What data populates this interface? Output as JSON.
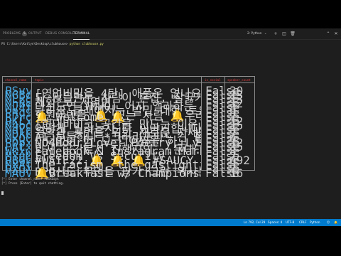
{
  "panel": {
    "tabs": [
      {
        "label": "PROBLEMS",
        "count": "5"
      },
      {
        "label": "OUTPUT",
        "count": ""
      },
      {
        "label": "DEBUG CONSOLE",
        "count": ""
      },
      {
        "label": "TERMINAL",
        "count": ""
      }
    ],
    "active_tab": "TERMINAL",
    "terminal_select": "2: Python",
    "icons": [
      "plus-icon",
      "split-icon",
      "trash-icon",
      "chevron-up-icon",
      "close-icon"
    ]
  },
  "terminal": {
    "prompt_line": {
      "prompt": "PS C:\\Users\\Kotlyn\\Desktop\\clubhouse>",
      "command": "python clubhouse.py"
    },
    "table": {
      "headers": [
        "channel_name",
        "topic",
        "is_social",
        "speaker_count"
      ],
      "rows": [
        {
          "name": "PSvyzkbn",
          "topic": "[영업비밀을 4탄] 애플은 없나요. 자목은주국로 M.정관 시연다",
          "social": "False",
          "count": "30"
        },
        {
          "name": "MGBdcXda",
          "topic": "되 많을만는 사람이 혼잡, 잘끓기 3편",
          "social": "False",
          "count": "13"
        },
        {
          "name": "MLzd7ErK",
          "topic": "체험 노 지역변",
          "social": "False",
          "count": "13"
        },
        {
          "name": "MnBqtYwx",
          "topic": "다전도연 (MVO) 어지 앨라하는 사람들은 수다방",
          "social": "False",
          "count": "12"
        },
        {
          "name": "Mv4fm40k",
          "topic": "근리오 클래에서는 발밑 대한 토요",
          "social": "False",
          "count": "8"
        },
        {
          "name": "PRq9nrUX",
          "topic": "학원무방들 🔔 있는 사람 🔔우리무방 규칙 동일 🔔친두와 섬지 기프티콘",
          "social": "False",
          "count": "9"
        },
        {
          "name": "R7roRMS3",
          "topic": "🔔 Welcome 🔔",
          "social": "False",
          "count": "7"
        },
        {
          "name": "PKLx5xsJ",
          "topic": "[현대바이크 공간을 만드는 이유]현대자인 출지하자에게 물어요:)",
          "social": "False",
          "count": "12"
        },
        {
          "name": "M4bdsKBE",
          "topic": "어떻게 밀랴는지 다 이야기합니다 🔔🔔 [정년다] 친척은 좋을듯",
          "social": "False",
          "count": "15"
        },
        {
          "name": "MdYqQYKk",
          "topic": "음악과 공연을 위한 새로운 자세와 꿈이 펼쳐를 거쳐친",
          "social": "False",
          "count": "5"
        },
        {
          "name": "MDkCmDlW",
          "topic": "AI 투툼하나 *크러리프피* 긴 철 변디 (~ 633 00:00)",
          "social": "False",
          "count": "7"
        },
        {
          "name": "MxQ0UeGM",
          "topic": "미덕없이 더 모 디이찜을 하고 탐장이요",
          "social": "False",
          "count": "6"
        },
        {
          "name": "PDpxKMWA",
          "topic": "NO4Hour2Love: Poetry, Lyrics & You",
          "social": "False",
          "count": "12"
        },
        {
          "name": "PAtxnDNH",
          "topic": "와세 공간로서 진행지의...문대...",
          "social": "False",
          "count": "35"
        },
        {
          "name": "Wkxw4V8",
          "topic": "Facebook & Instagram Marketing SECRETS 🔥💸🤑🤑",
          "social": "False",
          "count": "8"
        },
        {
          "name": "MYgMnEVy",
          "topic": "Freedom Vs Security",
          "social": "False",
          "count": "7"
        },
        {
          "name": "PBGhG84M",
          "topic": "#WAIF22 🔔 🔔 🔔 #SAUCY 🔔 AAAGEXXXX 🔔 ThankYou 🔔 AAXXXX",
          "social": "False",
          "count": "692"
        },
        {
          "name": "MXAfCUg",
          "topic": "The racism, the gaslighting, the foolishness in that room?",
          "social": "False",
          "count": "5"
        },
        {
          "name": "PXGXKCNF",
          "topic": "BPO산도 무언을 팡가 그런 워사는 것을 모두 모두 합쳐봐요...",
          "social": "False",
          "count": "7"
        },
        {
          "name": "MAUVR4MQ",
          "topic": "🔔Breakfast w/ Champions 🔔The Millionaire Breakfast Club",
          "social": "False",
          "count": "16"
        }
      ]
    },
    "after_lines": [
      "[*] Enter channel_name: PKSXGdyk",
      "[*] Press [Enter] to quit chatting."
    ]
  },
  "statusbar": {
    "position": "Ln 792, Col 29",
    "spaces": "Spaces: 4",
    "encoding": "UTF-8",
    "eol": "CRLF",
    "language": "Python"
  }
}
